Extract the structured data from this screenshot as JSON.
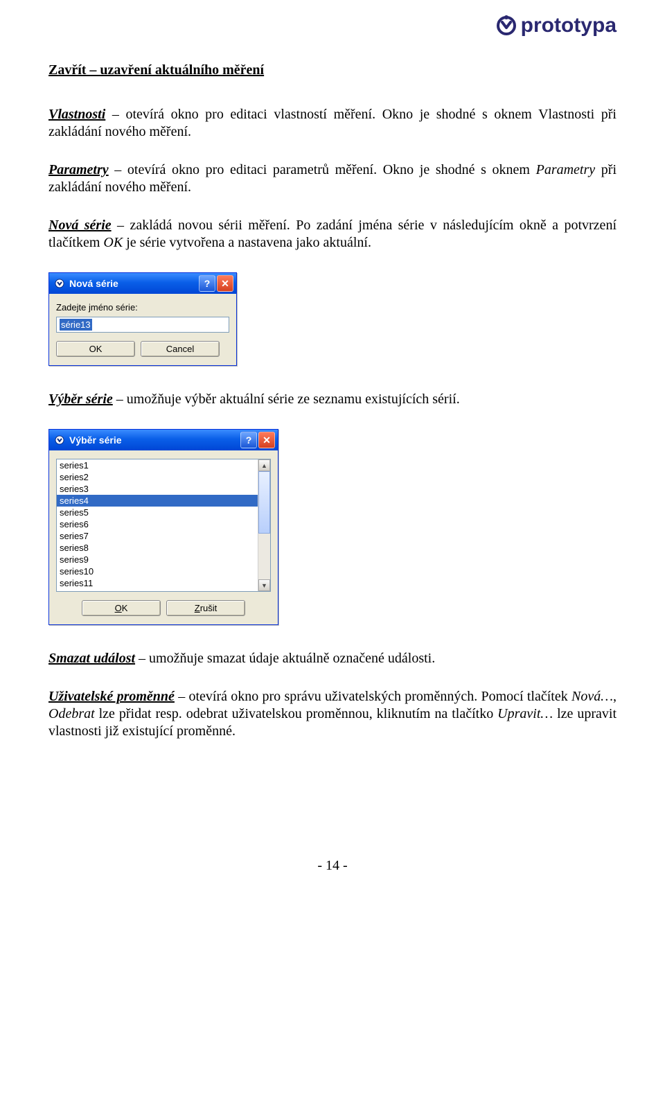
{
  "brand": "prototypa",
  "heading_text": "Zavřít – uzavření aktuálního měření",
  "paragraphs": {
    "p1_term": "Vlastnosti",
    "p1_rest": " – otevírá okno pro editaci vlastností měření. Okno je shodné s oknem Vlastnosti při zakládání nového měření.",
    "p2_term": "Parametry",
    "p2_rest": " – otevírá okno pro editaci parametrů měření. Okno je shodné s oknem ",
    "p2_italic": "Parametry",
    "p2_tail": " při zakládání nového měření.",
    "p3_term": "Nová série",
    "p3_rest": " – zakládá novou sérii měření. Po zadání jména série v následujícím okně a potvrzení tlačítkem ",
    "p3_italic": "OK",
    "p3_tail": " je série vytvořena a nastavena jako aktuální.",
    "p4_term": "Výběr série",
    "p4_rest": " – umožňuje výběr aktuální série ze seznamu existujících sérií.",
    "p5_term": "Smazat událost",
    "p5_rest": " – umožňuje smazat údaje aktuálně označené události.",
    "p6_term": "Uživatelské proměnné",
    "p6_rest": " – otevírá okno pro správu uživatelských proměnných. Pomocí tlačítek ",
    "p6_i1": "Nová…",
    "p6_mid": ", ",
    "p6_i2": "Odebrat",
    "p6_mid2": " lze přidat resp. odebrat uživatelskou proměnnou, kliknutím na tlačítko ",
    "p6_i3": "Upravit…",
    "p6_tail": " lze upravit vlastnosti již existující proměnné."
  },
  "dialog1": {
    "title": "Nová série",
    "label": "Zadejte jméno série:",
    "value": "série13",
    "ok": "OK",
    "cancel": "Cancel"
  },
  "dialog2": {
    "title": "Výběr série",
    "items": [
      "series1",
      "series2",
      "series3",
      "series4",
      "series5",
      "series6",
      "series7",
      "series8",
      "series9",
      "series10",
      "series11"
    ],
    "selected_index": 3,
    "ok_mnemonic": "O",
    "ok_rest": "K",
    "cancel_mnemonic": "Z",
    "cancel_rest": "rušit"
  },
  "pagenum": "- 14 -"
}
